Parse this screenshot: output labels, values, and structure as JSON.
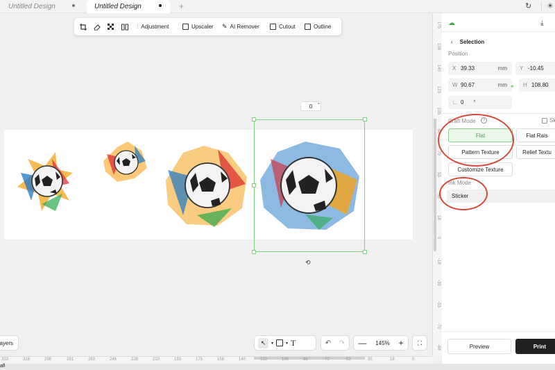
{
  "tabs": [
    {
      "label": "Untitled Design"
    },
    {
      "label": "Untitled Design"
    }
  ],
  "new_tab": "+",
  "toolbar": {
    "adjustment": "Adjustment",
    "upscaler": "Upscaler",
    "ai_remover": "AI Remover",
    "cutout": "Cutout",
    "outline": "Outline"
  },
  "canvas": {
    "rotation_value": "0",
    "rotation_unit": "°"
  },
  "bottom": {
    "layers": "ayers",
    "zoom": "145%",
    "zoom_minus": "—",
    "zoom_plus": "+"
  },
  "ruler_h": [
    "333",
    "316",
    "298",
    "281",
    "263",
    "246",
    "228",
    "210",
    "193",
    "175",
    "158",
    "140",
    "123",
    "105",
    "88",
    "70",
    "53",
    "35",
    "18",
    "0"
  ],
  "ruler_v": [
    "175",
    "158",
    "140",
    "123",
    "105",
    "88",
    "70",
    "53",
    "35",
    "18",
    "0",
    "-18",
    "-35",
    "-53",
    "-70",
    "-88"
  ],
  "panel": {
    "selection": "Selection",
    "position": "Position",
    "x_label": "X",
    "x_value": "39.33",
    "x_unit": "mm",
    "y_label": "Y",
    "y_value": "-10.45",
    "w_label": "W",
    "w_value": "90.67",
    "w_unit": "mm",
    "h_label": "H",
    "h_value": "108.80",
    "angle_label": "∟",
    "angle_value": "0",
    "angle_unit": "°",
    "craft_mode": "Craft Mode",
    "skip": "Ski",
    "flat": "Flat",
    "flat_raised": "Flat Rais",
    "pattern_texture": "Pattern Texture",
    "relief_texture": "Relief Textu",
    "customize_texture": "Customize Texture",
    "ink_mode": "Ink Mode",
    "sticker": "Sticker",
    "preview": "Preview",
    "print": "Print"
  },
  "taskbar_text": "afl",
  "colors": {
    "selection_green": "#7fcf7f",
    "accent_green": "#4aa84a",
    "annotation_red": "#d64a3a",
    "print_bg": "#222222"
  }
}
